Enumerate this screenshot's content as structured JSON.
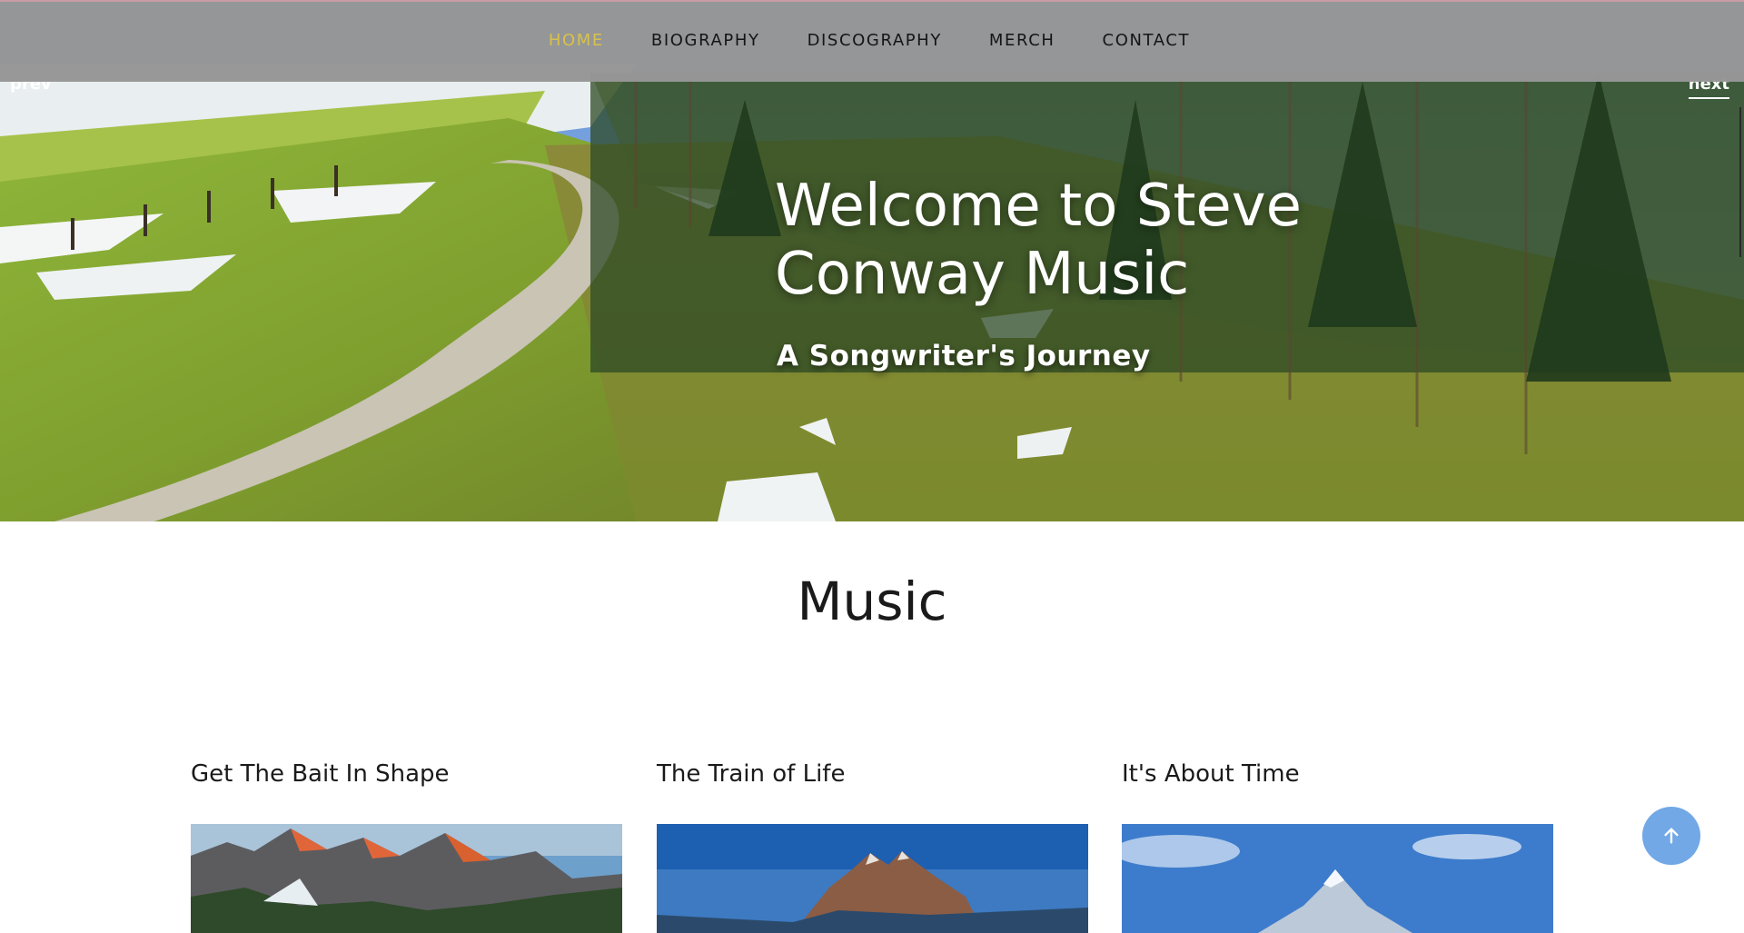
{
  "nav": {
    "items": [
      {
        "label": "HOME",
        "active": true
      },
      {
        "label": "BIOGRAPHY",
        "active": false
      },
      {
        "label": "DISCOGRAPHY",
        "active": false
      },
      {
        "label": "MERCH",
        "active": false
      },
      {
        "label": "CONTACT",
        "active": false
      }
    ],
    "active_color": "#d8c24a"
  },
  "slider": {
    "prev_label": "prev",
    "next_label": "next"
  },
  "hero": {
    "title": "Welcome to Steve Conway Music",
    "subtitle": "A Songwriter's Journey"
  },
  "music": {
    "heading": "Music",
    "cards": [
      {
        "title": "Get The Bait In Shape"
      },
      {
        "title": "The Train of Life"
      },
      {
        "title": "It's About Time"
      }
    ]
  },
  "colors": {
    "nav_background": "#969696",
    "back_to_top": "#72a8e6"
  },
  "icons": {
    "back_to_top": "arrow-up-icon"
  }
}
